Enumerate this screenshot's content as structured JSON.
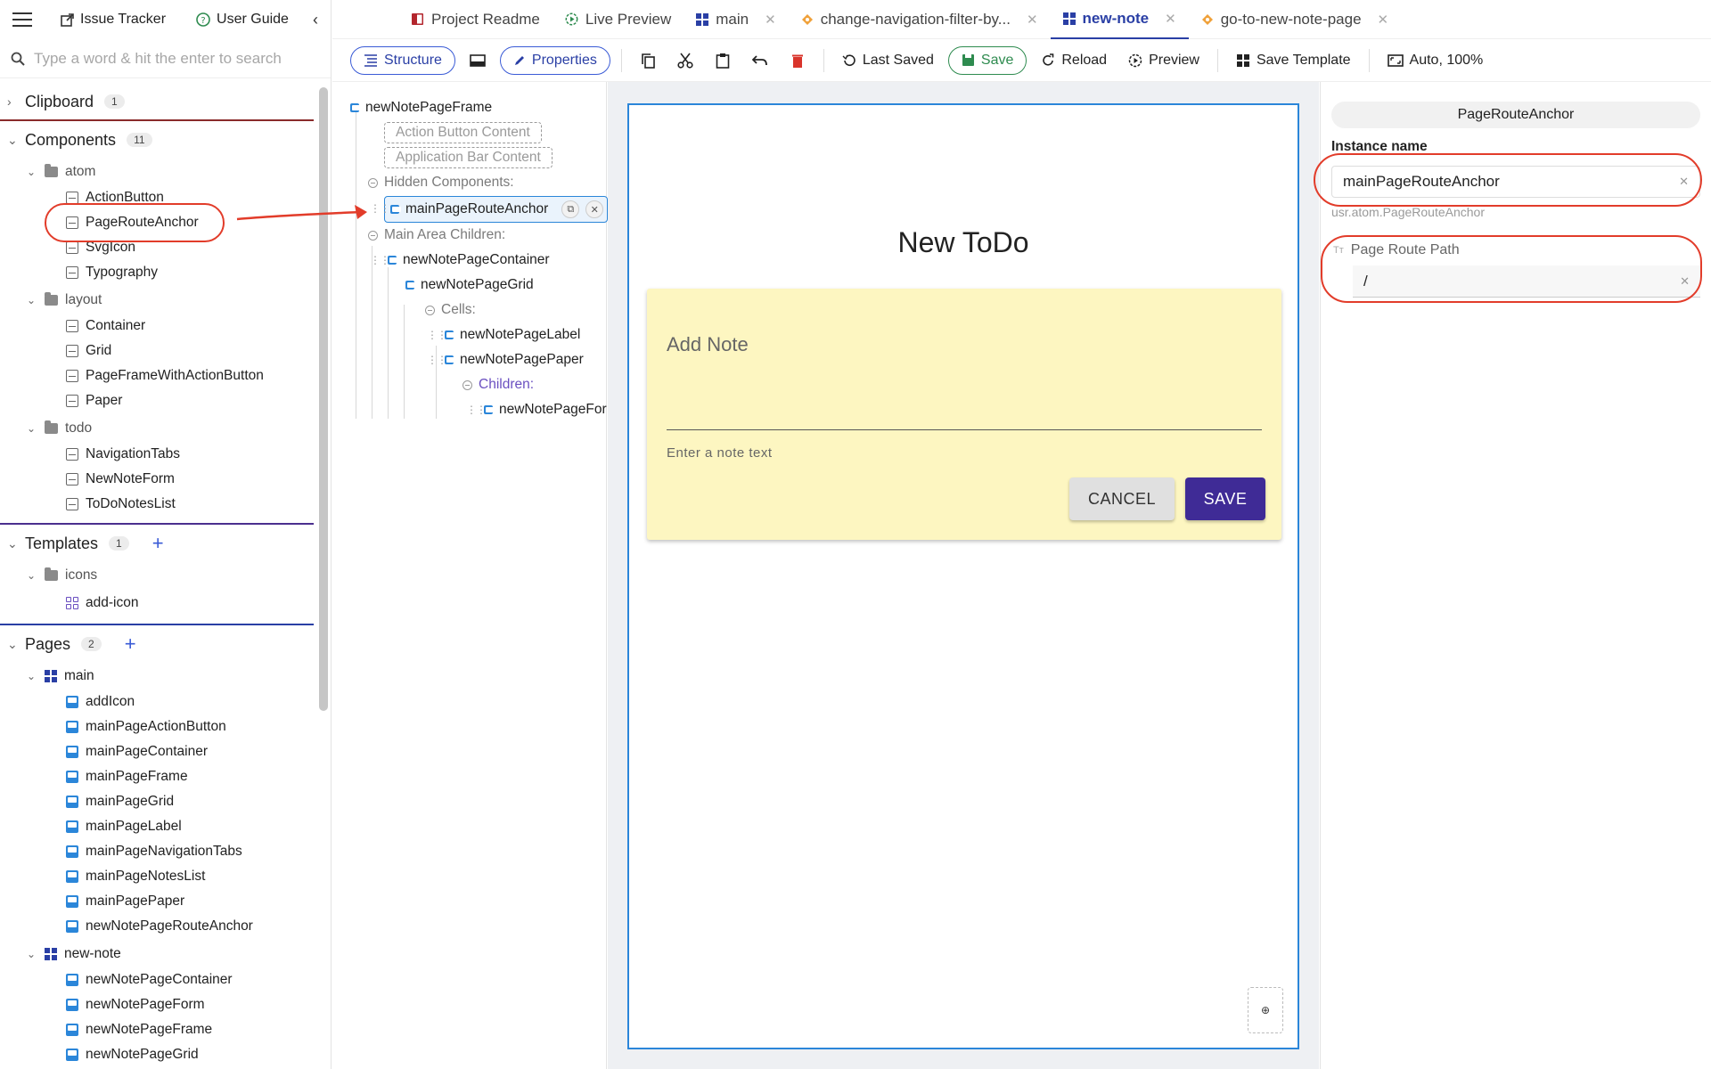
{
  "topbar": {
    "issue_tracker": "Issue Tracker",
    "user_guide": "User Guide"
  },
  "search": {
    "placeholder": "Type a word & hit the enter to search"
  },
  "sections": {
    "clipboard": {
      "label": "Clipboard",
      "count": "1"
    },
    "components": {
      "label": "Components",
      "count": "11"
    },
    "templates": {
      "label": "Templates",
      "count": "1"
    },
    "pages": {
      "label": "Pages",
      "count": "2"
    }
  },
  "components_tree": {
    "atom": "atom",
    "atom_items": [
      "ActionButton",
      "PageRouteAnchor",
      "SvgIcon",
      "Typography"
    ],
    "layout": "layout",
    "layout_items": [
      "Container",
      "Grid",
      "PageFrameWithActionButton",
      "Paper"
    ],
    "todo": "todo",
    "todo_items": [
      "NavigationTabs",
      "NewNoteForm",
      "ToDoNotesList"
    ]
  },
  "templates_tree": {
    "icons": "icons",
    "items": [
      "add-icon"
    ]
  },
  "pages_tree": {
    "main": "main",
    "main_items": [
      "addIcon",
      "mainPageActionButton",
      "mainPageContainer",
      "mainPageFrame",
      "mainPageGrid",
      "mainPageLabel",
      "mainPageNavigationTabs",
      "mainPageNotesList",
      "mainPagePaper",
      "newNotePageRouteAnchor"
    ],
    "new_note": "new-note",
    "new_note_items": [
      "newNotePageContainer",
      "newNotePageForm",
      "newNotePageFrame",
      "newNotePageGrid"
    ]
  },
  "tabs": [
    {
      "label": "Project Readme"
    },
    {
      "label": "Live Preview"
    },
    {
      "label": "main"
    },
    {
      "label": "change-navigation-filter-by..."
    },
    {
      "label": "new-note"
    },
    {
      "label": "go-to-new-note-page"
    }
  ],
  "toolbar": {
    "structure": "Structure",
    "properties": "Properties",
    "last_saved": "Last Saved",
    "save": "Save",
    "reload": "Reload",
    "preview": "Preview",
    "save_template": "Save Template",
    "zoom": "Auto, 100%"
  },
  "structure": {
    "root": "newNotePageFrame",
    "action_button_content": "Action Button Content",
    "application_bar_content": "Application Bar Content",
    "hidden_components": "Hidden Components:",
    "selected": "mainPageRouteAnchor",
    "main_area_children": "Main Area Children:",
    "container": "newNotePageContainer",
    "grid": "newNotePageGrid",
    "cells": "Cells:",
    "label": "newNotePageLabel",
    "paper": "newNotePagePaper",
    "children": "Children:",
    "form": "newNotePageFor"
  },
  "canvas": {
    "title": "New ToDo",
    "note_label": "Add Note",
    "note_helper": "Enter a note text",
    "cancel": "CANCEL",
    "save": "SAVE",
    "corner": "⊕"
  },
  "properties": {
    "component_name": "PageRouteAnchor",
    "instance_name_label": "Instance name",
    "instance_name_value": "mainPageRouteAnchor",
    "instance_hint": "usr.atom.PageRouteAnchor",
    "route_path_label": "Page Route Path",
    "route_path_value": "/"
  },
  "colors": {
    "accent": "#2a3fa5",
    "selection": "#2b86d9",
    "save_green": "#2e8b4f",
    "annotation_red": "#e23c2a",
    "paper_yellow": "#fdf6c1",
    "primary_button": "#3f2b96"
  }
}
